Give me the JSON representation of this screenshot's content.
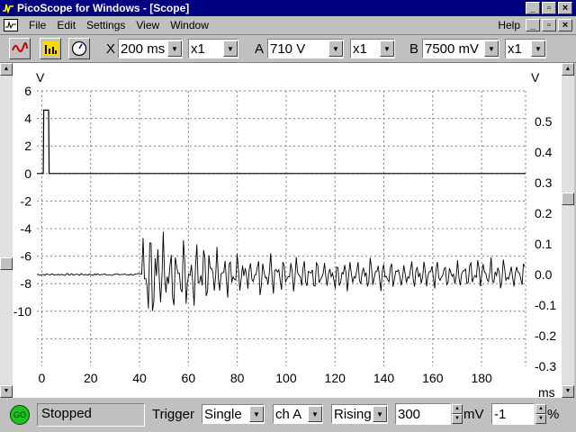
{
  "window": {
    "title": "PicoScope for Windows - [Scope]"
  },
  "menu": {
    "items": [
      "File",
      "Edit",
      "Settings",
      "View",
      "Window"
    ],
    "help": "Help"
  },
  "toolbar": {
    "x_label": "X",
    "timebase": "200 ms",
    "x_mult": "x1",
    "a_label": "A",
    "a_range": "710 V",
    "a_mult": "x1",
    "b_label": "B",
    "b_range": "7500 mV",
    "b_mult": "x1"
  },
  "status": {
    "go_label": "GO",
    "state": "Stopped",
    "trigger_label": "Trigger",
    "trigger_mode": "Single",
    "trigger_channel": "ch A",
    "trigger_edge": "Rising",
    "trigger_level": "300",
    "trigger_unit": "mV",
    "trigger_delay": "-1",
    "delay_unit": "%"
  },
  "chart_data": {
    "type": "line",
    "title": "",
    "xlabel": "ms",
    "xlim": [
      -2,
      198
    ],
    "x_ticks": [
      0,
      20,
      40,
      60,
      80,
      100,
      120,
      140,
      160,
      180
    ],
    "left_axis": {
      "label": "V",
      "ticks": [
        6,
        4,
        2,
        0,
        -2,
        -4,
        -6,
        -8,
        -10
      ],
      "range": [
        -14,
        6
      ]
    },
    "right_axis": {
      "label": "V",
      "ticks": [
        0.5,
        0.4,
        0.3,
        0.2,
        0.1,
        0.0,
        -0.1,
        -0.2,
        -0.3
      ],
      "range": [
        -0.3,
        0.6
      ]
    },
    "grid": true,
    "series": [
      {
        "name": "A",
        "axis": "left",
        "color": "#000000",
        "description_points": [
          [
            -2,
            0
          ],
          [
            0.6,
            0
          ],
          [
            0.8,
            4.6
          ],
          [
            2.8,
            4.6
          ],
          [
            3,
            0
          ],
          [
            198,
            0
          ]
        ]
      },
      {
        "name": "B",
        "axis": "right",
        "color": "#000000",
        "baseline": 0.0,
        "onset_ms": 41,
        "peak_amplitude": 0.22,
        "decay_amplitude": 0.06,
        "end_ms": 198
      }
    ]
  }
}
